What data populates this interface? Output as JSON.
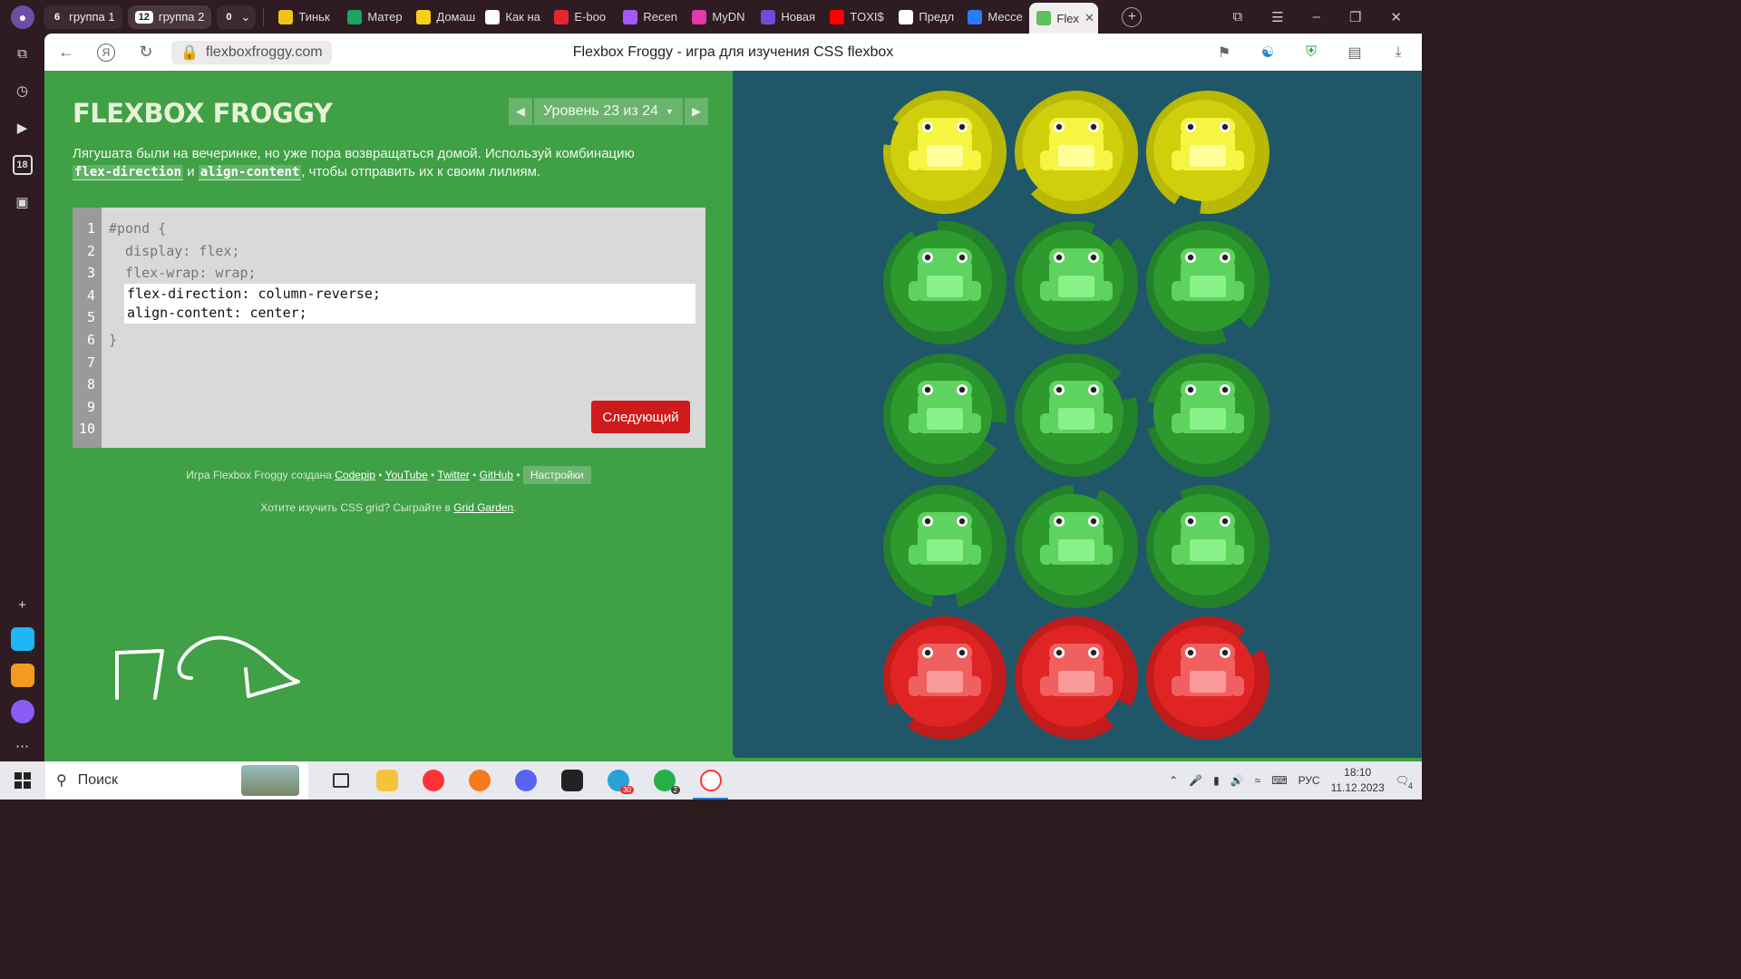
{
  "browser": {
    "tab_groups": [
      {
        "count": "6",
        "label": "группа 1"
      },
      {
        "count": "12",
        "label": "группа 2"
      },
      {
        "count": "0",
        "label": ""
      }
    ],
    "tabs": [
      {
        "label": "Тиньк",
        "color": "#f0c419"
      },
      {
        "label": "Матер",
        "color": "#1ea362"
      },
      {
        "label": "Домаш",
        "color": "#f7d117"
      },
      {
        "label": "Как на",
        "color": "#ffffff"
      },
      {
        "label": "E-boo",
        "color": "#e6262e"
      },
      {
        "label": "Recen",
        "color": "#a259ff"
      },
      {
        "label": "MyDN",
        "color": "#e23aa6"
      },
      {
        "label": "Новая",
        "color": "#6f4bd8"
      },
      {
        "label": "TOXI$",
        "color": "#ff0000"
      },
      {
        "label": "Предл",
        "color": "#ffffff"
      },
      {
        "label": "Мессе",
        "color": "#2a7cf6"
      },
      {
        "label": "Flex",
        "color": "#5fbf5f"
      }
    ],
    "url": "flexboxfroggy.com",
    "page_title": "Flexbox Froggy - игра для изучения CSS flexbox",
    "sidebar_date": "18"
  },
  "game": {
    "logo": "FLEXBOX FROGGY",
    "level_label": "Уровень 23 из 24",
    "instructions_pre": "Лягушата были на вечеринке, но уже пора возвращаться домой. Используй комбинацию",
    "code1": "flex-direction",
    "and": "и",
    "code2": "align-content",
    "instructions_post": ", чтобы отправить их к своим лилиям.",
    "line_numbers": [
      "1",
      "2",
      "3",
      "4",
      "5",
      "6",
      "7",
      "8",
      "9",
      "10"
    ],
    "code_lines": [
      "#pond {",
      "  display: flex;",
      "  flex-wrap: wrap;",
      "",
      "",
      "}"
    ],
    "input_lines": [
      "flex-direction: column-reverse;",
      "align-content: center;"
    ],
    "next_button": "Следующий",
    "footer_credit": "Игра Flexbox Froggy создана",
    "footer_links": [
      "Codepip",
      "YouTube",
      "Twitter",
      "GitHub"
    ],
    "settings": "Настройки",
    "footer_grid_pre": "Хотите изучить CSS grid? Сыграйте в",
    "footer_grid_link": "Grid Garden",
    "footer_grid_post": "."
  },
  "pond": {
    "rows": [
      [
        "yellow",
        "yellow",
        "yellow"
      ],
      [
        "green",
        "green",
        "green"
      ],
      [
        "green",
        "green",
        "green"
      ],
      [
        "green",
        "green",
        "green"
      ],
      [
        "red",
        "red",
        "red"
      ]
    ],
    "colors": {
      "yellow": {
        "pad": "#cfcf0c",
        "pad_dark": "#b8b805",
        "frog": "#f5f542",
        "belly": "#ffff99"
      },
      "green": {
        "pad": "#2e9a2e",
        "pad_dark": "#23812a",
        "frog": "#5fd35f",
        "belly": "#8af28a"
      },
      "red": {
        "pad": "#e02424",
        "pad_dark": "#c21b1b",
        "frog": "#f06060",
        "belly": "#fa9a9a"
      }
    }
  },
  "taskbar": {
    "search_placeholder": "Поиск",
    "language": "РУС",
    "time": "18:10",
    "date": "11.12.2023",
    "notifications": "4",
    "telegram_badge": "30",
    "whatsapp_badge": "2"
  }
}
